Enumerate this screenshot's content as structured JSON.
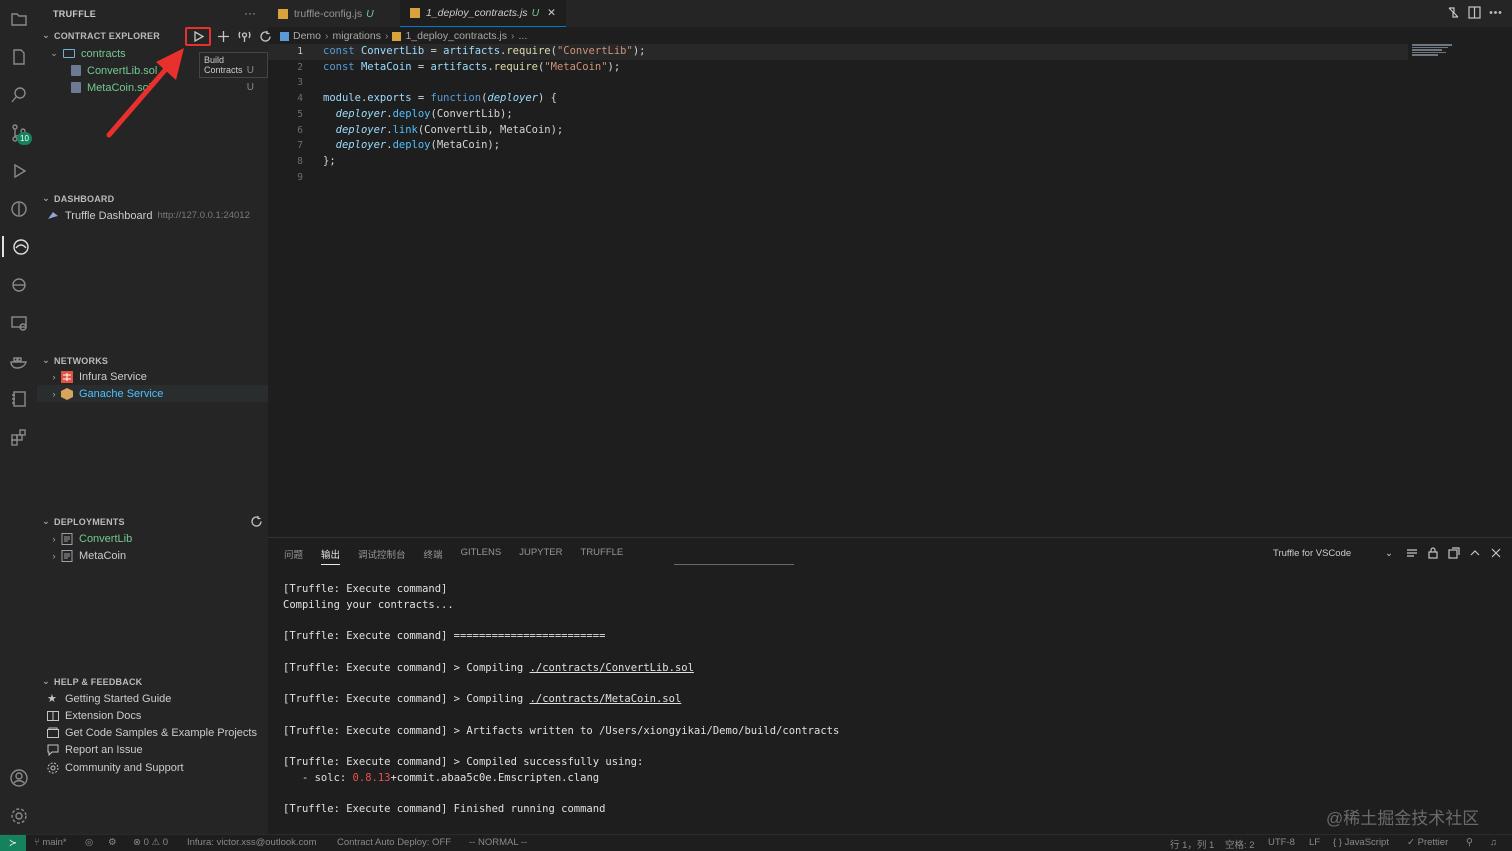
{
  "sidebar": {
    "title": "TRUFFLE",
    "more": "···",
    "contract_explorer": {
      "header": "CONTRACT EXPLORER",
      "tooltip": "Build Contracts",
      "folder": "contracts",
      "files": [
        {
          "name": "ConvertLib.sol",
          "status": "U"
        },
        {
          "name": "MetaCoin.sol",
          "status": "U"
        }
      ]
    },
    "dashboard": {
      "header": "DASHBOARD",
      "item_label": "Truffle Dashboard",
      "item_url": "http://127.0.0.1:24012"
    },
    "networks": {
      "header": "NETWORKS",
      "items": [
        "Infura Service",
        "Ganache Service"
      ]
    },
    "deployments": {
      "header": "DEPLOYMENTS",
      "items": [
        "ConvertLib",
        "MetaCoin"
      ]
    },
    "help": {
      "header": "HELP & FEEDBACK",
      "items": [
        "Getting Started Guide",
        "Extension Docs",
        "Get Code Samples & Example Projects",
        "Report an Issue",
        "Community and Support"
      ]
    }
  },
  "activity": {
    "scm_badge": "10"
  },
  "editor": {
    "tabs": [
      {
        "label": "truffle-config.js",
        "status": "U"
      },
      {
        "label": "1_deploy_contracts.js",
        "status": "U"
      }
    ],
    "breadcrumb": [
      "Demo",
      "migrations",
      "1_deploy_contracts.js",
      "..."
    ],
    "line_numbers": [
      "1",
      "2",
      "3",
      "4",
      "5",
      "6",
      "7",
      "8",
      "9"
    ]
  },
  "panel": {
    "tabs": [
      "问题",
      "输出",
      "调试控制台",
      "终端",
      "GITLENS",
      "JUPYTER",
      "TRUFFLE"
    ],
    "active_tab": "输出",
    "channel": "Truffle for VSCode",
    "output": {
      "l1": "[Truffle: Execute command]",
      "l2": "Compiling your contracts...",
      "l3": "[Truffle: Execute command] ========================",
      "l4_pre": "[Truffle: Execute command] > Compiling ",
      "l4_link": "./contracts/ConvertLib.sol",
      "l5_pre": "[Truffle: Execute command] > Compiling ",
      "l5_link": "./contracts/MetaCoin.sol",
      "l6": "[Truffle: Execute command] > Artifacts written to /Users/xiongyikai/Demo/build/contracts",
      "l7": "[Truffle: Execute command] > Compiled successfully using:",
      "l8_pre": "   - solc: ",
      "l8_ver": "0.8.13",
      "l8_post": "+commit.abaa5c0e.Emscripten.clang",
      "l9": "[Truffle: Execute command] Finished running command"
    }
  },
  "statusbar": {
    "branch": "main*",
    "errors": "0",
    "warnings": "0",
    "infura": "Infura: victor.xss@outlook.com",
    "auto_deploy": "Contract Auto Deploy: OFF",
    "mode": "-- NORMAL --",
    "position": "行 1，列 1",
    "spaces": "空格: 2",
    "encoding": "UTF-8",
    "eol": "LF",
    "language": "JavaScript",
    "prettier": "Prettier"
  },
  "watermark": "@稀土掘金技术社区"
}
